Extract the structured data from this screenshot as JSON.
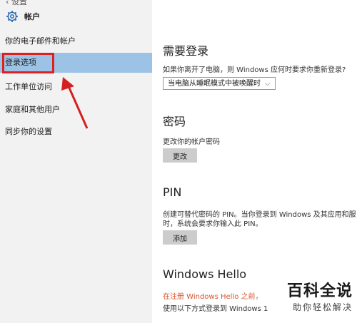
{
  "sidebar": {
    "topbar_fragment": "‹ 设置",
    "header_title": "帐户",
    "items": [
      {
        "label": "你的电子邮件和帐户"
      },
      {
        "label": "登录选项"
      },
      {
        "label": "工作单位访问"
      },
      {
        "label": "家庭和其他用户"
      },
      {
        "label": "同步你的设置"
      }
    ]
  },
  "content": {
    "signin_required": {
      "title": "需要登录",
      "desc": "如果你离开了电脑，则 Windows 应何时要求你重新登录?",
      "dropdown_value": "当电脑从睡眠模式中被唤醒时"
    },
    "password": {
      "title": "密码",
      "desc": "更改你的帐户密码",
      "button": "更改"
    },
    "pin": {
      "title": "PIN",
      "desc_line1": "创建可替代密码的 PIN。当你登录到 Windows 及其应用和服",
      "desc_line2": "时，系统会要求你输入此 PIN。",
      "button": "添加"
    },
    "hello": {
      "title": "Windows Hello",
      "warning": "在注册 Windows Hello 之前，",
      "desc": "使用以下方式登录到 Windows 1"
    }
  },
  "watermark": {
    "logo": "百科全说",
    "subtitle": "助你轻松解决"
  },
  "colors": {
    "sidebar_bg": "#f2f2f2",
    "active_item": "#9cc3e6",
    "highlight_red": "#e02020",
    "warning_orange": "#d9532c"
  }
}
